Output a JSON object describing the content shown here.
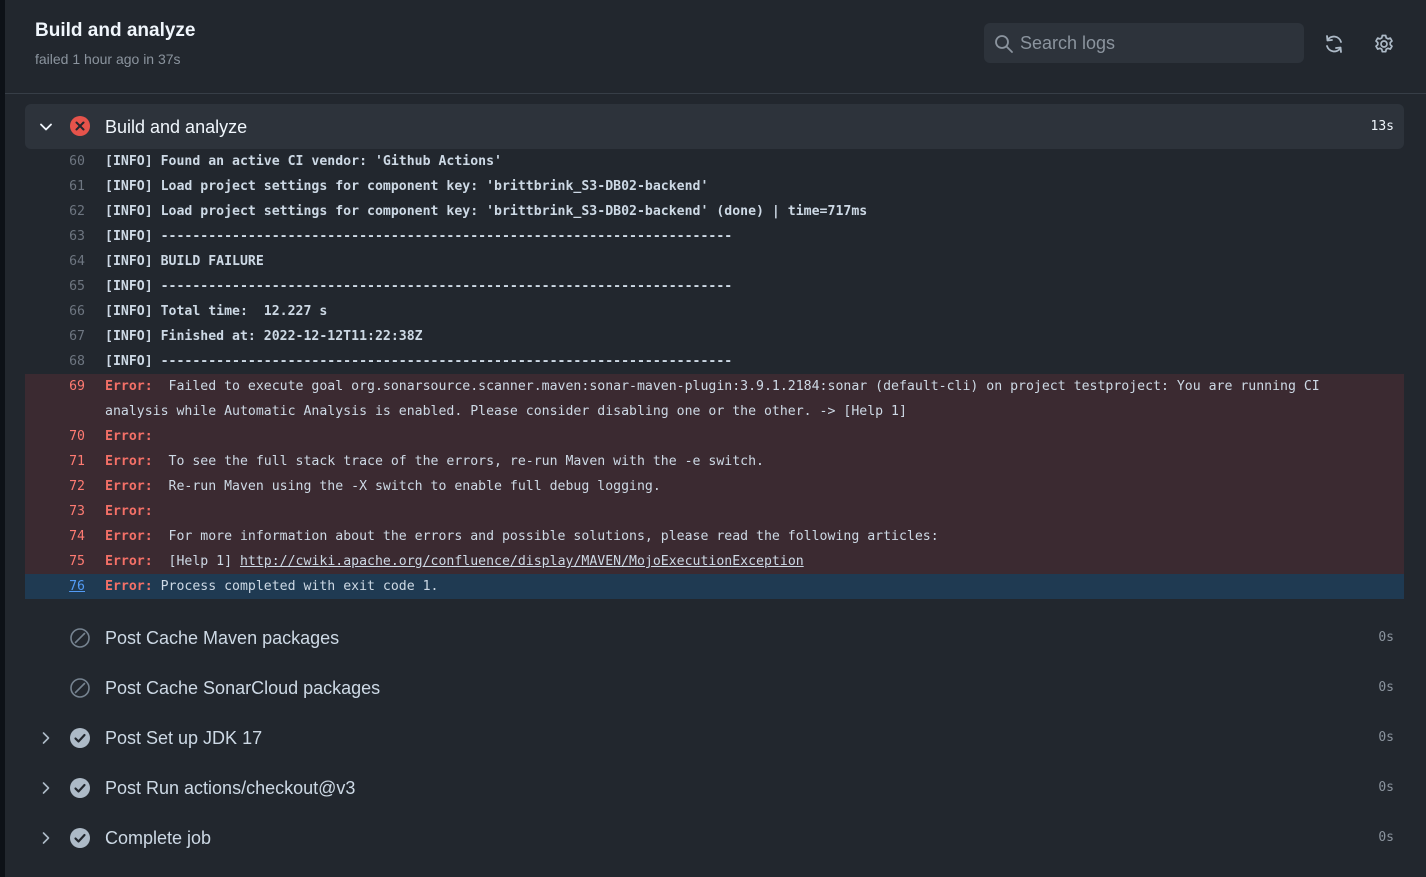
{
  "header": {
    "title": "Build and analyze",
    "status": "failed 1 hour ago in 37s",
    "search_placeholder": "Search logs"
  },
  "step": {
    "name": "Build and analyze",
    "duration": "13s",
    "status": "failed"
  },
  "log_lines": [
    {
      "num": "60",
      "type": "info",
      "text": "[INFO] Found an active CI vendor: 'Github Actions'"
    },
    {
      "num": "61",
      "type": "info",
      "text": "[INFO] Load project settings for component key: 'brittbrink_S3-DB02-backend'"
    },
    {
      "num": "62",
      "type": "info",
      "text": "[INFO] Load project settings for component key: 'brittbrink_S3-DB02-backend' (done) | time=717ms"
    },
    {
      "num": "63",
      "type": "info",
      "text": "[INFO] ------------------------------------------------------------------------"
    },
    {
      "num": "64",
      "type": "info",
      "text": "[INFO] BUILD FAILURE"
    },
    {
      "num": "65",
      "type": "info",
      "text": "[INFO] ------------------------------------------------------------------------"
    },
    {
      "num": "66",
      "type": "info",
      "text": "[INFO] Total time:  12.227 s"
    },
    {
      "num": "67",
      "type": "info",
      "text": "[INFO] Finished at: 2022-12-12T11:22:38Z"
    },
    {
      "num": "68",
      "type": "info",
      "text": "[INFO] ------------------------------------------------------------------------"
    },
    {
      "num": "69",
      "type": "error",
      "prefix": "Error: ",
      "text": " Failed to execute goal org.sonarsource.scanner.maven:sonar-maven-plugin:3.9.1.2184:sonar (default-cli) on project testproject: You are running CI analysis while Automatic Analysis is enabled. Please consider disabling one or the other. -> [Help 1]"
    },
    {
      "num": "70",
      "type": "error",
      "prefix": "Error: ",
      "text": ""
    },
    {
      "num": "71",
      "type": "error",
      "prefix": "Error: ",
      "text": " To see the full stack trace of the errors, re-run Maven with the -e switch."
    },
    {
      "num": "72",
      "type": "error",
      "prefix": "Error: ",
      "text": " Re-run Maven using the -X switch to enable full debug logging."
    },
    {
      "num": "73",
      "type": "error",
      "prefix": "Error: ",
      "text": ""
    },
    {
      "num": "74",
      "type": "error",
      "prefix": "Error: ",
      "text": " For more information about the errors and possible solutions, please read the following articles:"
    },
    {
      "num": "75",
      "type": "error",
      "prefix": "Error: ",
      "text": " [Help 1] ",
      "link": "http://cwiki.apache.org/confluence/display/MAVEN/MojoExecutionException"
    },
    {
      "num": "76",
      "type": "highlight",
      "prefix": "Error: ",
      "text": "Process completed with exit code 1."
    }
  ],
  "other_steps": [
    {
      "name": "Post Cache Maven packages",
      "duration": "0s",
      "status": "skipped",
      "expandable": false
    },
    {
      "name": "Post Cache SonarCloud packages",
      "duration": "0s",
      "status": "skipped",
      "expandable": false
    },
    {
      "name": "Post Set up JDK 17",
      "duration": "0s",
      "status": "success",
      "expandable": true
    },
    {
      "name": "Post Run actions/checkout@v3",
      "duration": "0s",
      "status": "success",
      "expandable": true
    },
    {
      "name": "Complete job",
      "duration": "0s",
      "status": "success",
      "expandable": true
    }
  ],
  "colors": {
    "background": "#22272e",
    "error_text": "#f47067",
    "error_row": "#3b2a31",
    "highlight_row": "#1f3a52",
    "link": "#539bf5"
  }
}
